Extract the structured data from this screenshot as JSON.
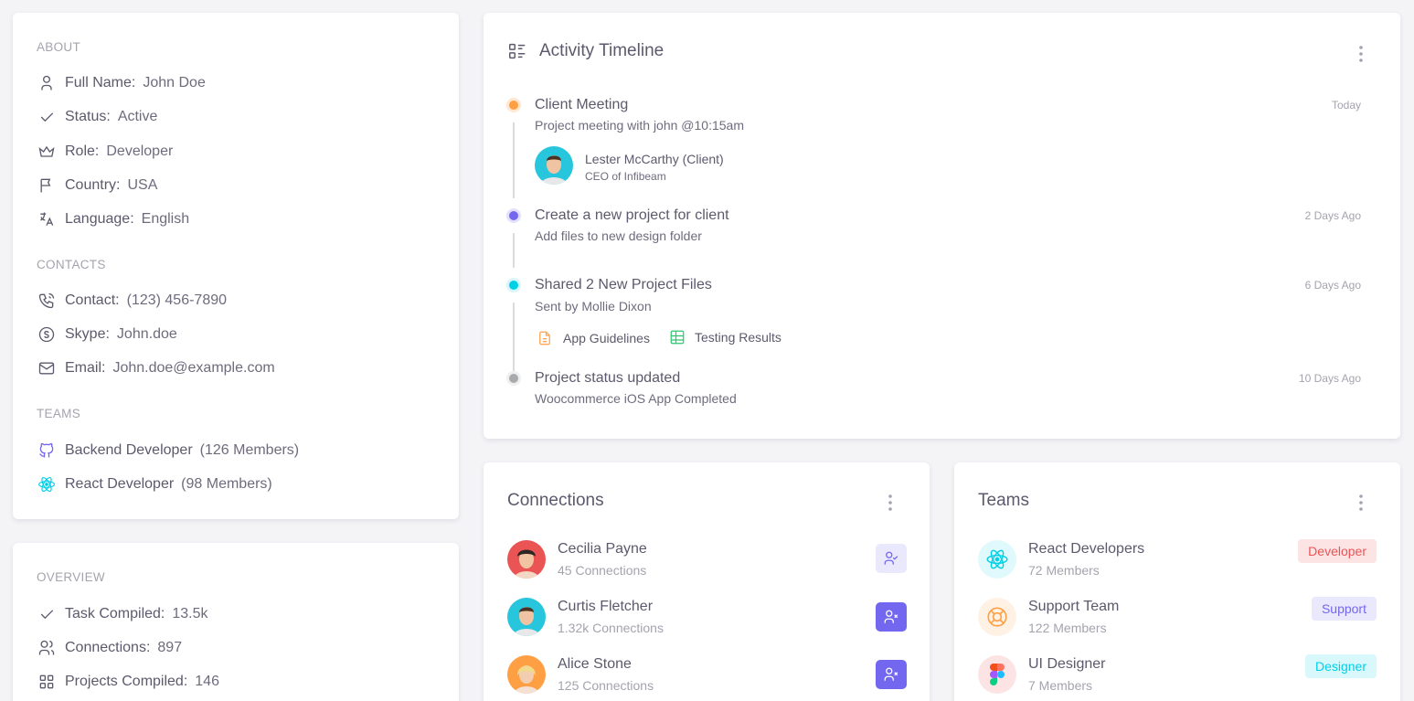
{
  "about": {
    "section_title": "ABOUT",
    "items": [
      {
        "icon": "user-icon",
        "label": "Full Name:",
        "value": "John Doe"
      },
      {
        "icon": "check-icon",
        "label": "Status:",
        "value": "Active"
      },
      {
        "icon": "crown-icon",
        "label": "Role:",
        "value": "Developer"
      },
      {
        "icon": "flag-icon",
        "label": "Country:",
        "value": "USA"
      },
      {
        "icon": "language-icon",
        "label": "Language:",
        "value": "English"
      }
    ],
    "contacts_title": "CONTACTS",
    "contacts": [
      {
        "icon": "phone-icon",
        "label": "Contact:",
        "value": "(123) 456-7890"
      },
      {
        "icon": "skype-icon",
        "label": "Skype:",
        "value": "John.doe"
      },
      {
        "icon": "mail-icon",
        "label": "Email:",
        "value": "John.doe@example.com"
      }
    ],
    "teams_title": "TEAMS",
    "teams": [
      {
        "icon": "github-icon",
        "label": "Backend Developer",
        "value": "(126 Members)"
      },
      {
        "icon": "react-icon",
        "label": "React Developer",
        "value": "(98 Members)"
      }
    ]
  },
  "overview": {
    "section_title": "OVERVIEW",
    "items": [
      {
        "icon": "check-icon",
        "label": "Task Compiled:",
        "value": "13.5k"
      },
      {
        "icon": "users-icon",
        "label": "Connections:",
        "value": "897"
      },
      {
        "icon": "grid-icon",
        "label": "Projects Compiled:",
        "value": "146"
      }
    ]
  },
  "timeline": {
    "title": "Activity Timeline",
    "events": [
      {
        "title": "Client Meeting",
        "subtitle": "Project meeting with john @10:15am",
        "time": "Today",
        "color": "#ff9f43"
      },
      {
        "title": "Create a new project for client",
        "subtitle": "Add files to new design folder",
        "time": "2 Days Ago",
        "color": "#7367f0"
      },
      {
        "title": "Shared 2 New Project Files",
        "subtitle": "Sent by Mollie Dixon",
        "time": "6 Days Ago",
        "color": "#00cfe8"
      },
      {
        "title": "Project status updated",
        "subtitle": "Woocommerce iOS App Completed",
        "time": "10 Days Ago",
        "color": "#a8aaae"
      }
    ],
    "client": {
      "name": "Lester McCarthy (Client)",
      "role": "CEO of Infibeam"
    },
    "files": [
      {
        "icon": "document-icon",
        "name": "App Guidelines"
      },
      {
        "icon": "table-icon",
        "name": "Testing Results"
      }
    ]
  },
  "connections": {
    "title": "Connections",
    "items": [
      {
        "name": "Cecilia Payne",
        "sub": "45 Connections",
        "connected": true
      },
      {
        "name": "Curtis Fletcher",
        "sub": "1.32k Connections",
        "connected": false
      },
      {
        "name": "Alice Stone",
        "sub": "125 Connections",
        "connected": false
      }
    ]
  },
  "teams": {
    "title": "Teams",
    "items": [
      {
        "name": "React Developers",
        "sub": "72 Members",
        "badge": "Developer",
        "icon": "react-icon"
      },
      {
        "name": "Support Team",
        "sub": "122 Members",
        "badge": "Support",
        "icon": "lifebuoy-icon"
      },
      {
        "name": "UI Designer",
        "sub": "7 Members",
        "badge": "Designer",
        "icon": "figma-icon"
      }
    ]
  },
  "colors": {
    "primary": "#7367f0",
    "warning": "#ff9f43",
    "info": "#00cfe8",
    "danger": "#ea5455",
    "success": "#28c76f",
    "secondary": "#a8aaae"
  }
}
